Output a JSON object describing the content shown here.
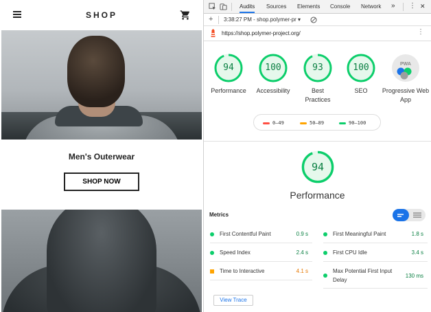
{
  "shop": {
    "title": "SHOP",
    "category": "Men's Outerwear",
    "cta_label": "SHOP NOW"
  },
  "devtools": {
    "tabs": [
      "Audits",
      "Sources",
      "Elements",
      "Console",
      "Network"
    ],
    "more_tabs": "»",
    "menu_icon": "⋮",
    "close_icon": "✕",
    "run_selector": "3:38:27 PM - shop.polymer-pr ▾",
    "new_icon": "+",
    "url": "https://shop.polymer-project.org/",
    "pwa_badge": "PWA"
  },
  "scores": [
    {
      "label": "Performance",
      "value": "94",
      "fraction": 0.94
    },
    {
      "label": "Accessibility",
      "value": "100",
      "fraction": 1.0
    },
    {
      "label": "Best Practices",
      "value": "93",
      "fraction": 0.93
    },
    {
      "label": "SEO",
      "value": "100",
      "fraction": 1.0
    },
    {
      "label": "Progressive Web App",
      "value": "",
      "fraction": null
    }
  ],
  "legend": [
    {
      "range": "0–49",
      "color": "#ff4e42"
    },
    {
      "range": "50–89",
      "color": "#ffa400"
    },
    {
      "range": "90–100",
      "color": "#0cce6b"
    }
  ],
  "performance": {
    "title": "Performance",
    "score": "94",
    "fraction": 0.94,
    "metrics_title": "Metrics",
    "view_trace": "View Trace",
    "metrics_left": [
      {
        "name": "First Contentful Paint",
        "value": "0.9 s",
        "status": "good"
      },
      {
        "name": "Speed Index",
        "value": "2.4 s",
        "status": "good"
      },
      {
        "name": "Time to Interactive",
        "value": "4.1 s",
        "status": "avg"
      }
    ],
    "metrics_right": [
      {
        "name": "First Meaningful Paint",
        "value": "1.8 s",
        "status": "good"
      },
      {
        "name": "First CPU Idle",
        "value": "3.4 s",
        "status": "good"
      },
      {
        "name": "Max Potential First Input",
        "name2": "Delay",
        "value": "130 ms",
        "status": "good"
      }
    ]
  },
  "colors": {
    "good": "#0cce6b",
    "good_text": "#0b8043",
    "average": "#ffa400",
    "accent": "#1a73e8"
  }
}
